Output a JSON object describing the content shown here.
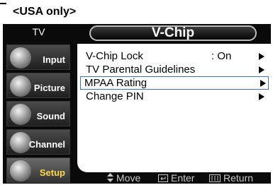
{
  "region_note": "<USA only>",
  "sidebar": {
    "title": "TV",
    "items": [
      {
        "label": "Input",
        "icon": "input-plug-icon"
      },
      {
        "label": "Picture",
        "icon": "picture-icon"
      },
      {
        "label": "Sound",
        "icon": "sound-icon"
      },
      {
        "label": "Channel",
        "icon": "channel-antenna-icon"
      },
      {
        "label": "Setup",
        "icon": "setup-icon",
        "active": true
      }
    ]
  },
  "header": {
    "title": "V-Chip"
  },
  "menu": {
    "items": [
      {
        "label": "V-Chip Lock",
        "value": ": On"
      },
      {
        "label": "TV Parental Guidelines",
        "value": ""
      },
      {
        "label": "MPAA Rating",
        "value": "",
        "selected": true
      },
      {
        "label": "Change PIN",
        "value": ""
      }
    ]
  },
  "footer": {
    "move": "Move",
    "enter": "Enter",
    "return": "Return"
  },
  "colors": {
    "osd_background": "#0a0a0a",
    "active_label": "#ffd84a",
    "selection_border": "#3a6fd8"
  }
}
